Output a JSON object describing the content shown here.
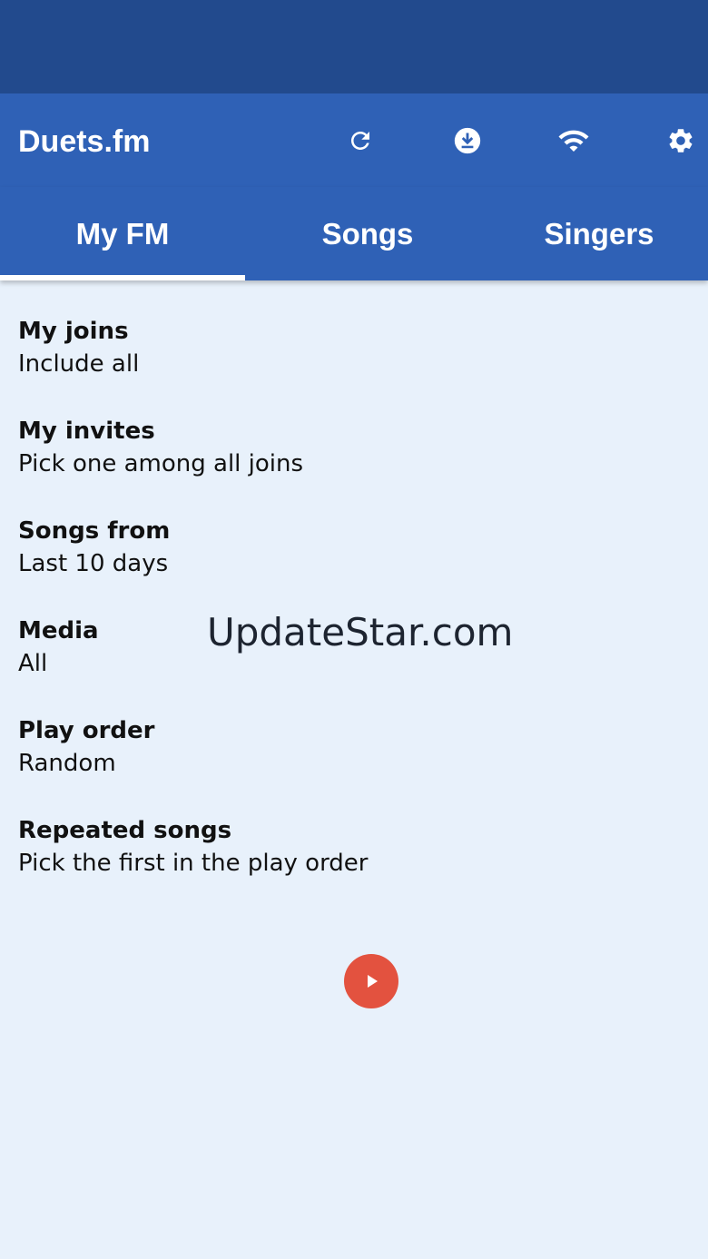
{
  "app": {
    "title": "Duets.fm"
  },
  "toolbar": {
    "actions": [
      {
        "icon": "refresh-icon"
      },
      {
        "icon": "download-icon"
      },
      {
        "icon": "wifi-icon"
      },
      {
        "icon": "gear-icon"
      }
    ]
  },
  "tabs": [
    {
      "label": "My FM",
      "selected": true
    },
    {
      "label": "Songs",
      "selected": false
    },
    {
      "label": "Singers",
      "selected": false
    }
  ],
  "settings": [
    {
      "label": "My joins",
      "value": "Include all"
    },
    {
      "label": "My invites",
      "value": "Pick one among all joins"
    },
    {
      "label": "Songs from",
      "value": "Last 10 days"
    },
    {
      "label": "Media",
      "value": "All"
    },
    {
      "label": "Play order",
      "value": "Random"
    },
    {
      "label": "Repeated songs",
      "value": "Pick the first in the play order"
    }
  ],
  "play_button": {
    "icon": "play-icon"
  },
  "watermark": "UpdateStar.com",
  "colors": {
    "status_bar": "#224a8d",
    "app_bar": "#2f61b6",
    "background": "#e8f1fb",
    "play_button": "#e3523f",
    "tab_indicator": "#ffffff"
  }
}
